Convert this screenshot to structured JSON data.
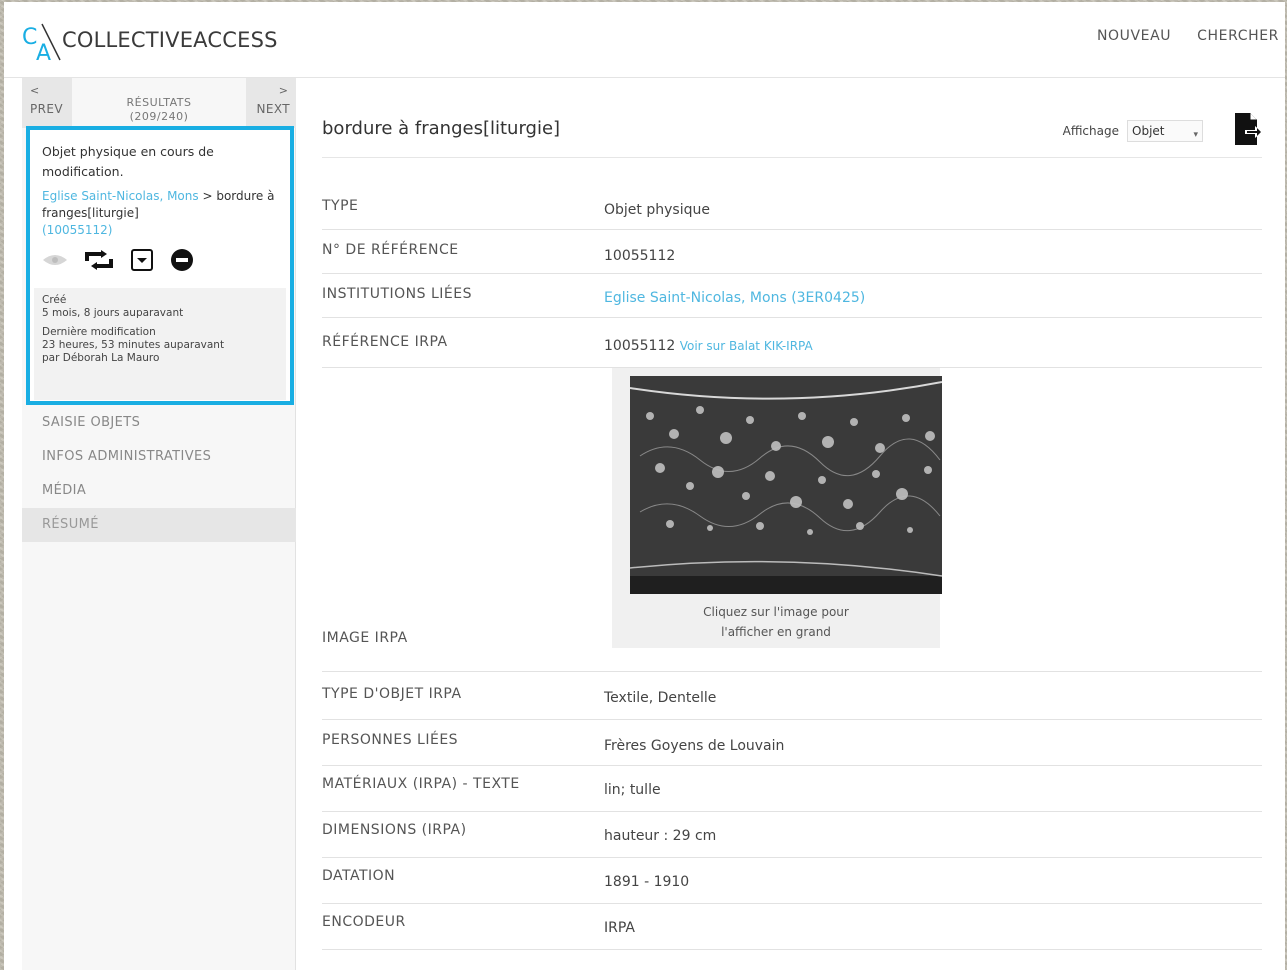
{
  "app": {
    "logo_text": "COLLECTIVEACCESS",
    "nav": [
      "NOUVEAU",
      "CHERCHER"
    ]
  },
  "sidebar": {
    "prev": {
      "arrow": "<",
      "label": "PREV"
    },
    "next": {
      "arrow": ">",
      "label": "NEXT"
    },
    "results_label": "RÉSULTATS",
    "results_count": "(209/240)",
    "status": "Objet physique en cours de modification.",
    "crumb_link": "Eglise Saint-Nicolas, Mons",
    "crumb_sep": " > ",
    "crumb_object": "bordure à franges[liturgie]",
    "crumb_id": "(10055112)",
    "meta": {
      "created_label": "Créé",
      "created_value": "5 mois, 8 jours auparavant",
      "modified_label": "Dernière modification",
      "modified_value": "23 heures, 53 minutes auparavant",
      "modified_by": "par Déborah La Mauro"
    },
    "menu": [
      "SAISIE OBJETS",
      "INFOS ADMINISTRATIVES",
      "MÉDIA",
      "RÉSUMÉ"
    ]
  },
  "main": {
    "title": "bordure à franges[liturgie]",
    "display_label": "Affichage",
    "display_value": "Objet",
    "fields": [
      {
        "label": "TYPE",
        "value": "Objet physique"
      },
      {
        "label": "N° DE RÉFÉRENCE",
        "value": "10055112"
      },
      {
        "label": "INSTITUTIONS LIÉES",
        "link": "Eglise Saint-Nicolas, Mons (3ER0425)"
      },
      {
        "label": "RÉFÉRENCE IRPA",
        "value": "10055112",
        "link": "Voir sur Balat KIK-IRPA"
      },
      {
        "label": "IMAGE IRPA",
        "caption_line1": "Cliquez sur l'image pour",
        "caption_line2": "l'afficher en grand"
      },
      {
        "label": "TYPE D'OBJET IRPA",
        "value": "Textile, Dentelle"
      },
      {
        "label": "PERSONNES LIÉES",
        "value": "Frères Goyens de Louvain"
      },
      {
        "label": "MATÉRIAUX (IRPA) - TEXTE",
        "value": "lin; tulle"
      },
      {
        "label": "DIMENSIONS (IRPA)",
        "value": "hauteur : 29 cm"
      },
      {
        "label": "DATATION",
        "value": "1891 - 1910"
      },
      {
        "label": "ENCODEUR",
        "value": "IRPA"
      }
    ]
  },
  "colors": {
    "accent": "#19aee3",
    "link": "#4fb7e0"
  },
  "icons": [
    "eye-icon",
    "duplicate-icon",
    "dropdown-box-icon",
    "delete-icon",
    "export-document-icon"
  ]
}
